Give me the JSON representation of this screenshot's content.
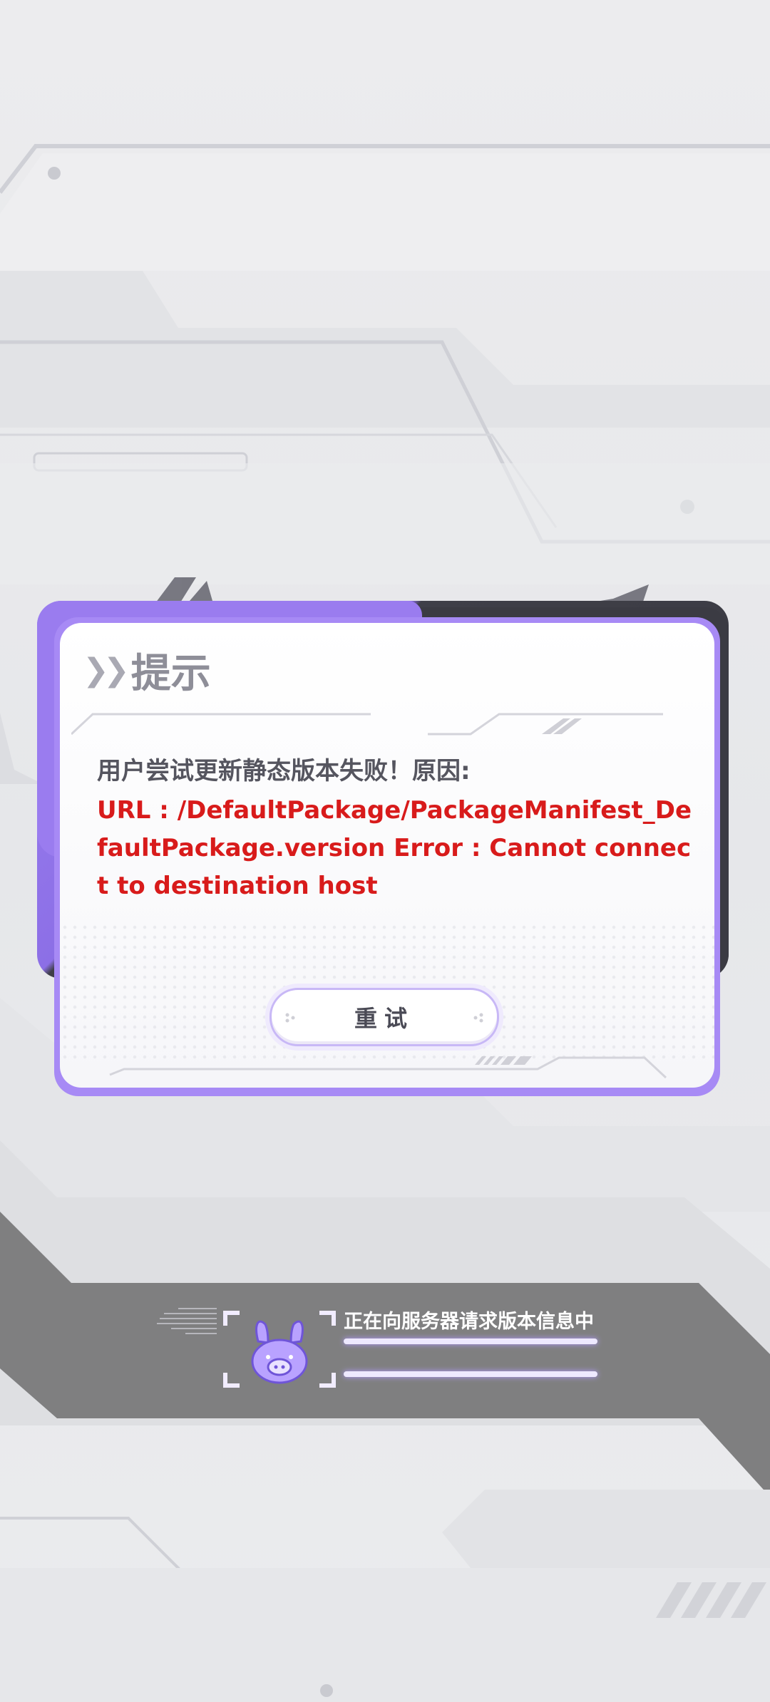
{
  "dialog": {
    "title": "提示",
    "message": "用户尝试更新静态版本失败！原因:",
    "error_text": "URL : /DefaultPackage/PackageManifest_DefaultPackage.version Error : Cannot connect to destination host",
    "retry_label": "重试"
  },
  "loading": {
    "status_text": "正在向服务器请求版本信息中"
  },
  "colors": {
    "accent_purple": "#9a7cef",
    "error_red": "#d81b1b",
    "band_gray": "#808080"
  },
  "icons": {
    "title_chevrons": "double-chevron-right-icon",
    "mascot": "rabbit-mascot-icon"
  }
}
